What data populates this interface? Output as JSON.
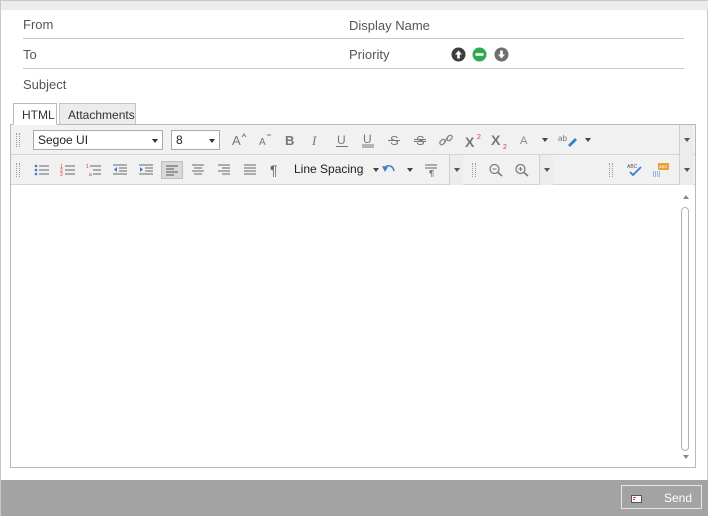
{
  "header": {
    "from_label": "From",
    "display_name_label": "Display Name",
    "to_label": "To",
    "priority_label": "Priority",
    "priority_icons": [
      "priority-high-icon",
      "priority-normal-icon",
      "priority-low-icon"
    ],
    "subject_label": "Subject"
  },
  "tabs": [
    {
      "label": "HTML",
      "active": true
    },
    {
      "label": "Attachments",
      "active": false
    }
  ],
  "toolbar1": {
    "font_family": "Segoe UI",
    "font_size": "8",
    "icons": [
      "grow-font-icon",
      "shrink-font-icon",
      "bold-icon",
      "italic-icon",
      "underline-icon",
      "double-underline-icon",
      "strikethrough-icon",
      "double-strikethrough-icon",
      "hyperlink-icon",
      "superscript-icon",
      "subscript-icon",
      "font-color-icon",
      "highlight-icon"
    ]
  },
  "toolbar2": {
    "line_spacing_label": "Line Spacing",
    "icons": [
      "bullets-icon",
      "numbering-icon",
      "multilevel-list-icon",
      "decrease-indent-icon",
      "increase-indent-icon",
      "align-left-icon",
      "align-center-icon",
      "align-right-icon",
      "justify-icon",
      "show-paragraph-icon",
      "undo-icon",
      "paragraph-marks-icon",
      "zoom-out-icon",
      "zoom-in-icon",
      "spell-check-icon",
      "spelling-options-icon"
    ]
  },
  "footer": {
    "send_label": "Send"
  },
  "colors": {
    "footer_bg": "#a3a3a3",
    "priority_high": "#3d3d3d",
    "priority_normal": "#2fa84f",
    "priority_low": "#6e6e6e"
  }
}
